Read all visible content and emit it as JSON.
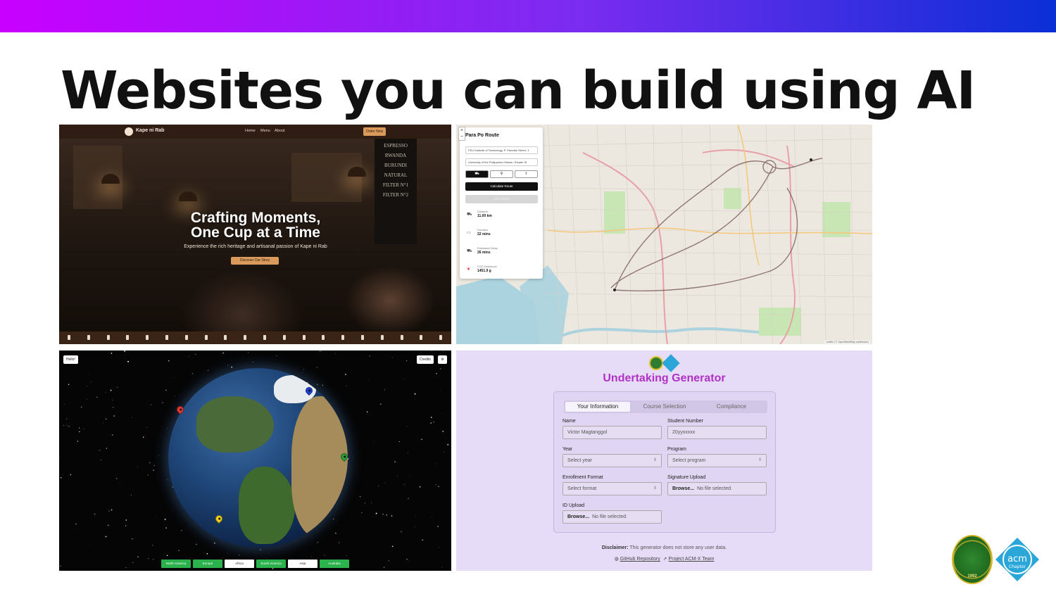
{
  "slide": {
    "title": "Websites you can build using AI"
  },
  "cafe": {
    "brand": "Kape ni Rab",
    "nav_links": [
      "Home",
      "Menu",
      "About"
    ],
    "order_label": "Order Now",
    "headline_line1": "Crafting Moments,",
    "headline_line2": "One Cup at a Time",
    "subtitle": "Experience the rich heritage and artisanal passion of Kape ni Rab",
    "cta_label": "Discover Our Story",
    "board_text": [
      "ESPRESSO",
      "RWANDA",
      "BURUNDI",
      "NATURAL",
      "FILTER N°1",
      "FILTER N°2"
    ]
  },
  "route": {
    "title": "Para Po Route",
    "zoom_in": "+",
    "zoom_out": "−",
    "origin_value": "FEU Institute of Technology, P. Paredes Street, 1",
    "destination_value": "University of the Philippines Diliman, Ricarte St",
    "modes": [
      "car",
      "bike",
      "walk"
    ],
    "calculate_label": "Calculate Route",
    "clear_label": "Clear Route",
    "stats": [
      {
        "label": "Distance",
        "value": "11.00 km",
        "icon": "car-icon"
      },
      {
        "label": "Duration",
        "value": "22 mins",
        "icon": "bus-icon"
      },
      {
        "label": "Estimated Delay",
        "value": "26 mins",
        "icon": "car-icon"
      },
      {
        "label": "CO2 Emissions",
        "value": "1451.9 g",
        "icon": "leaf-icon"
      }
    ],
    "credit": "Leaflet | © OpenStreetMap contributors"
  },
  "globe": {
    "hello_label": "Hello!",
    "credits_label": "Credits",
    "settings_icon": "gear-icon",
    "pin_colors": [
      "#e53935",
      "#1e3fd6",
      "#2e9e3a",
      "#f2d21b"
    ],
    "continents": [
      {
        "label": "North America",
        "style": "green"
      },
      {
        "label": "Europe",
        "style": "green"
      },
      {
        "label": "Africa",
        "style": "white"
      },
      {
        "label": "South America",
        "style": "green"
      },
      {
        "label": "Asia",
        "style": "white"
      },
      {
        "label": "Australia",
        "style": "green"
      }
    ]
  },
  "form": {
    "title": "Undertaking Generator",
    "tabs": [
      "Your Information",
      "Course Selection",
      "Compliance"
    ],
    "active_tab": "Your Information",
    "name_label": "Name",
    "name_placeholder": "Victor Magtanggol",
    "student_number_label": "Student Number",
    "student_number_placeholder": "20yyxxxxx",
    "year_label": "Year",
    "year_value": "Select year",
    "program_label": "Program",
    "program_value": "Select program",
    "enrollment_label": "Enrollment Format",
    "enrollment_value": "Select format",
    "signature_label": "Signature Upload",
    "id_label": "ID Upload",
    "browse_label": "Browse...",
    "no_file": "No file selected.",
    "disclaimer_bold": "Disclaimer:",
    "disclaimer_text": "This generator does not store any user data.",
    "github_link": "GitHub Repository",
    "team_link": "Project ACM-X Team",
    "accent_color": "#b031c8"
  },
  "logos": {
    "seal_year": "1992",
    "acm_text": "acm",
    "acm_sub": "Chapter"
  }
}
